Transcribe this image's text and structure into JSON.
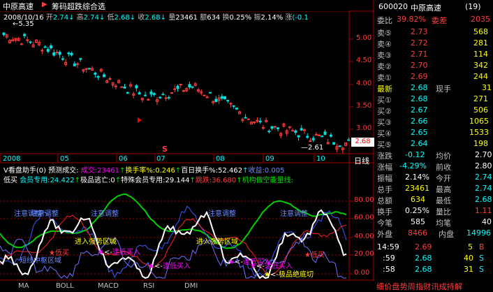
{
  "header": {
    "stock_name": "中原高速",
    "tool_title": "筹码超跌综合选",
    "arrow_glyph": "▶"
  },
  "ohlc_bar": {
    "date": "2008/10/16",
    "open_label": "开",
    "open": "2.74",
    "high_label": "高",
    "high": "2.74",
    "low_label": "低",
    "low": "2.68",
    "close_label": "收",
    "close": "2.68",
    "vol_label": "量",
    "vol": "23461",
    "amt_label": "额",
    "amt": "634",
    "turn_label": "换",
    "turn": "0.25%",
    "amp_label": "振",
    "amp": "2.14%",
    "chg_label": "涨",
    "chg": "(-0.1"
  },
  "price_axis": [
    "5.00",
    "4.50",
    "4.00",
    "3.50",
    "3.00"
  ],
  "price_high_marker": "5.35",
  "price_low_marker": "2.61",
  "current_price_tag": "2.68",
  "s_marker": "S",
  "date_axis": [
    "2008",
    "05",
    "06",
    "07",
    "08",
    "09",
    "10"
  ],
  "period_label": "日线",
  "indicator_header": {
    "name": "V看盘助手(0) 预测成交:",
    "vol_label": "成交:",
    "vol": "23461",
    "turn_label": "换手率%:",
    "turn": "0.246",
    "hundred_label": "百日换手%:",
    "hundred": "52.462",
    "profit_label": "收益:",
    "profit": "0.005"
  },
  "indicator_header2": {
    "low_buy": "低买",
    "member_label": "会员专用:",
    "member_val": "24.422",
    "escape_label": "极品逃亡:",
    "escape_val": "0",
    "special_label": "特殊会员专用:",
    "special_val": "29.144",
    "jump_label": "跳跌:",
    "jump_val": "36.680",
    "inst_label": "机构做空能量线:"
  },
  "indicator_axis": [
    "80.00",
    "60.00",
    "40.00",
    "20.00",
    "0.00"
  ],
  "annotations": {
    "adjust": "注意调整",
    "strong": "进入强势区域",
    "low_buy": "低买",
    "buy_low": "逢低买入",
    "bottom": "极品绝底切",
    "short_zone": "短线中枢区域"
  },
  "tabs": [
    "MA",
    "BOLL",
    "MACD",
    "RSI",
    "DMI"
  ],
  "quote": {
    "code": "600020",
    "name": "中原高速",
    "count": "(19)",
    "ratio_label": "委比",
    "ratio": "39.82%",
    "diff_label": "委差",
    "diff": "2035",
    "asks": [
      {
        "label": "卖⑤",
        "price": "2.73",
        "vol": "568"
      },
      {
        "label": "卖④",
        "price": "2.72",
        "vol": "281"
      },
      {
        "label": "卖③",
        "price": "2.71",
        "vol": "114"
      },
      {
        "label": "卖②",
        "price": "2.70",
        "vol": "342"
      },
      {
        "label": "卖①",
        "price": "2.69",
        "vol": "244"
      }
    ],
    "last_label": "最新",
    "last": "2.68",
    "hand_label": "现手",
    "hand": "31",
    "bids": [
      {
        "label": "买①",
        "price": "2.68",
        "vol": "271"
      },
      {
        "label": "买②",
        "price": "2.67",
        "vol": "506"
      },
      {
        "label": "买③",
        "price": "2.66",
        "vol": "1065"
      },
      {
        "label": "买④",
        "price": "2.65",
        "vol": "1533"
      },
      {
        "label": "买⑤",
        "price": "2.64",
        "vol": "198"
      }
    ],
    "stats": [
      {
        "l1": "涨跌",
        "v1": "-0.12",
        "l2": "均价",
        "v2": "2.70"
      },
      {
        "l1": "涨幅",
        "v1": "-4.29%",
        "l2": "前收",
        "v2": "2.80"
      },
      {
        "l1": "振幅",
        "v1": "2.14%",
        "l2": "今开",
        "v2": "2.74"
      },
      {
        "l1": "总手",
        "v1": "23461",
        "l2": "最高",
        "v2": "2.74"
      },
      {
        "l1": "总额",
        "v1": "634",
        "l2": "最低",
        "v2": "2.68"
      },
      {
        "l1": "换手",
        "v1": "0.25%",
        "l2": "量比",
        "v2": "1.11"
      },
      {
        "l1": "今笔",
        "v1": "585",
        "l2": "均笔",
        "v2": "40"
      }
    ],
    "outer_label": "外盘",
    "outer": "8466",
    "inner_label": "内盘",
    "inner": "14996",
    "ticks": [
      {
        "time": "14:59",
        "price": "2.69",
        "vol": "5",
        "side": "B"
      },
      {
        "time": ":59",
        "price": "2.68",
        "vol": "40",
        "side": "S"
      },
      {
        "time": ":58",
        "price": "2.68",
        "vol": "31",
        "side": "S"
      }
    ],
    "footer": "细价盘势周指财讯成持解"
  },
  "colors": {
    "up": "#ff3c3c",
    "down": "#00e0e0",
    "grid": "#a00000",
    "accent_yellow": "#ffff00"
  }
}
